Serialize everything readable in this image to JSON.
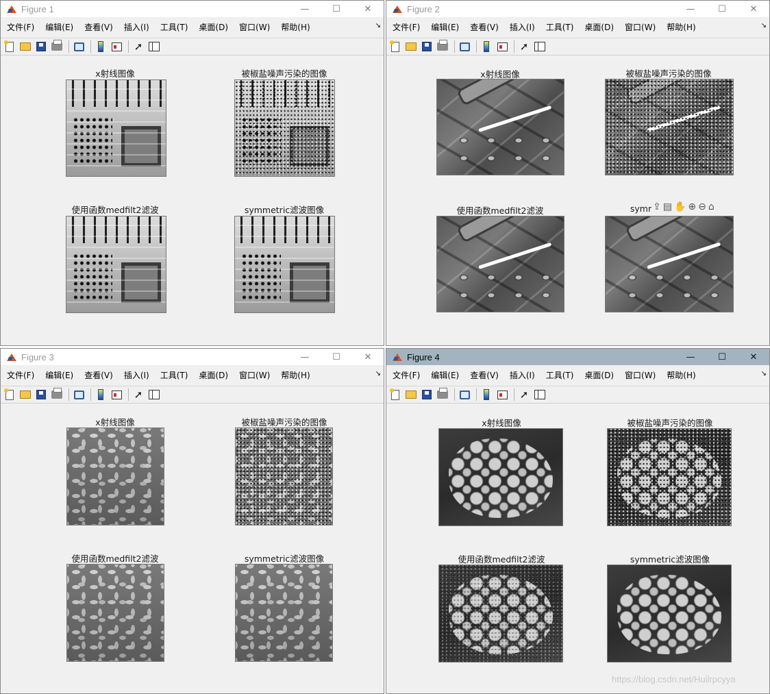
{
  "menu": [
    "文件(F)",
    "编辑(E)",
    "查看(V)",
    "插入(I)",
    "工具(T)",
    "桌面(D)",
    "窗口(W)",
    "帮助(H)"
  ],
  "menu_overflow": "↘",
  "window_controls": {
    "minimize": "—",
    "maximize": "☐",
    "close": "✕"
  },
  "axes_tools": [
    "⇪",
    "▤",
    "✋",
    "⊕",
    "⊖",
    "⌂"
  ],
  "windows": [
    {
      "title": "Figure 1",
      "active": false,
      "labels": {
        "tl": "x射线图像",
        "tr": "被椒盐噪声污染的图像",
        "bl": "使用函数medfilt2滤波",
        "br": "symmetric滤波图像"
      }
    },
    {
      "title": "Figure 2",
      "active": false,
      "labels": {
        "tl": "x射线图像",
        "tr": "被椒盐噪声污染的图像",
        "bl": "使用函数medfilt2滤波",
        "br": "symm"
      }
    },
    {
      "title": "Figure 3",
      "active": false,
      "labels": {
        "tl": "x射线图像",
        "tr": "被椒盐噪声污染的图像",
        "bl": "使用函数medfilt2滤波",
        "br": "symmetric滤波图像"
      }
    },
    {
      "title": "Figure 4",
      "active": true,
      "labels": {
        "tl": "x射线图像",
        "tr": "被椒盐噪声污染的图像",
        "bl": "使用函数medfilt2滤波",
        "br": "symmetric滤波图像"
      }
    }
  ],
  "watermark": "https://blog.csdn.net/Huilrpcyya"
}
